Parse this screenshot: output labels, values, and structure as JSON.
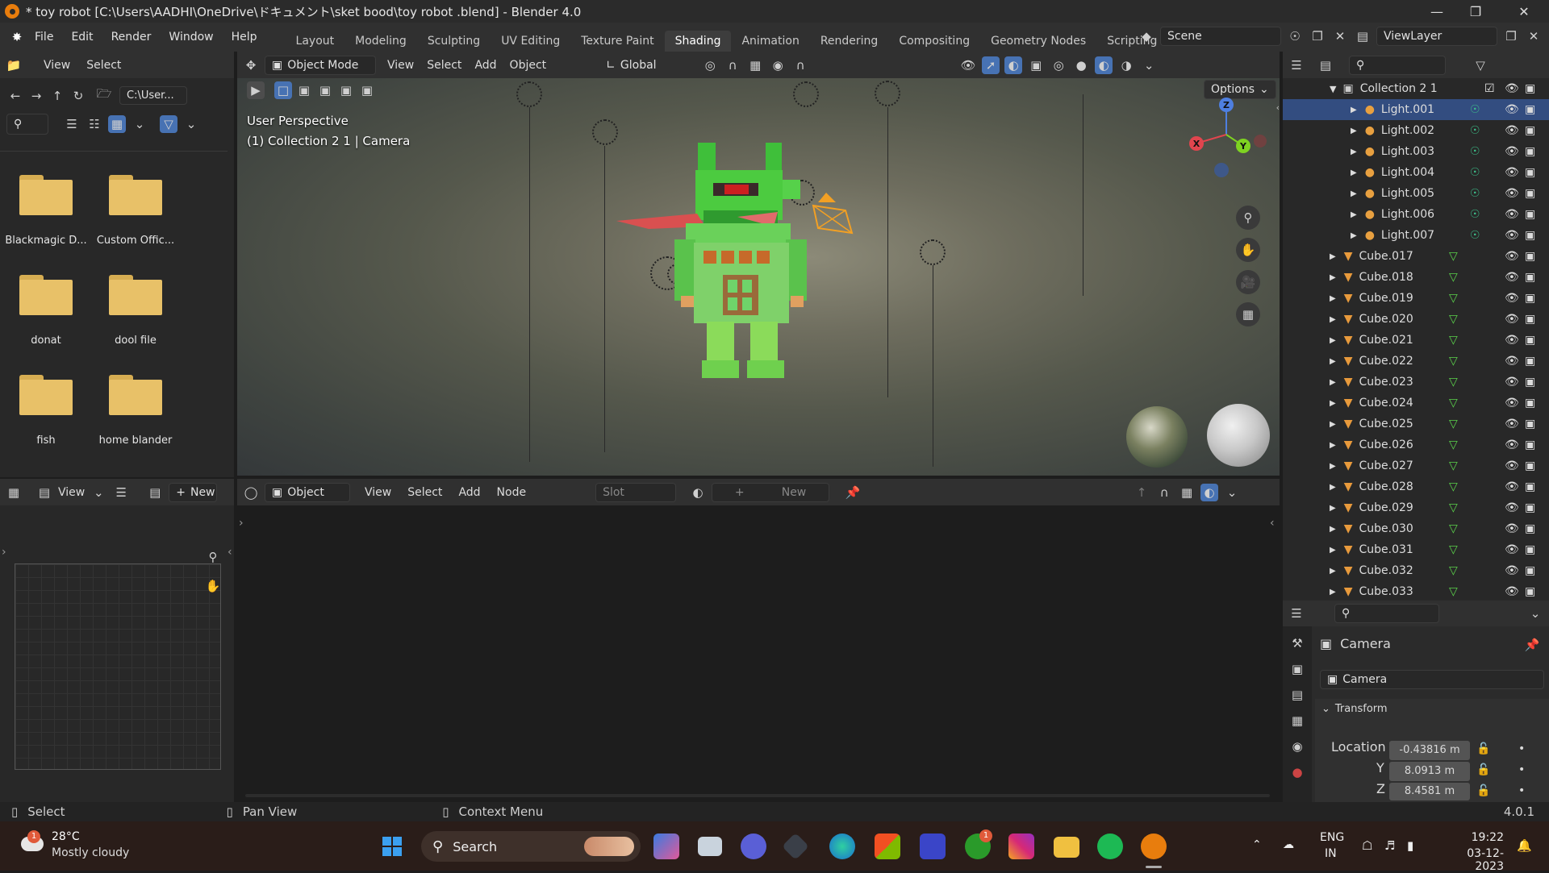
{
  "window": {
    "title": "* toy robot  [C:\\Users\\AADHI\\OneDrive\\ドキュメント\\sket bood\\toy robot .blend] - Blender 4.0"
  },
  "menu": [
    "File",
    "Edit",
    "Render",
    "Window",
    "Help"
  ],
  "workspaces": [
    "Layout",
    "Modeling",
    "Sculpting",
    "UV Editing",
    "Texture Paint",
    "Shading",
    "Animation",
    "Rendering",
    "Compositing",
    "Geometry Nodes",
    "Scripting"
  ],
  "active_workspace": "Shading",
  "scene": {
    "label": "Scene",
    "view_layer": "ViewLayer"
  },
  "filebrowser": {
    "view_label": "View",
    "select_label": "Select",
    "path": "C:\\User...",
    "folders": [
      "Blackmagic D...",
      "Custom Offic...",
      "donat",
      "dool file",
      "fish",
      "home blander"
    ]
  },
  "viewport": {
    "mode": "Object Mode",
    "menus": [
      "View",
      "Select",
      "Add",
      "Object"
    ],
    "transform": "Global",
    "options_label": "Options",
    "overlay_line1": "User Perspective",
    "overlay_line2": "(1) Collection 2 1 | Camera",
    "axes": {
      "x": "X",
      "y": "Y",
      "z": "Z"
    }
  },
  "image_editor": {
    "view_label": "View",
    "new_label": "New"
  },
  "node_editor": {
    "mode": "Object",
    "menus": [
      "View",
      "Select",
      "Add",
      "Node"
    ],
    "slot_label": "Slot",
    "new_label": "New"
  },
  "outliner": {
    "collection_label": "Collection 2 1",
    "lights": [
      "Light.001",
      "Light.002",
      "Light.003",
      "Light.004",
      "Light.005",
      "Light.006",
      "Light.007"
    ],
    "cubes": [
      "Cube.017",
      "Cube.018",
      "Cube.019",
      "Cube.020",
      "Cube.021",
      "Cube.022",
      "Cube.023",
      "Cube.024",
      "Cube.025",
      "Cube.026",
      "Cube.027",
      "Cube.028",
      "Cube.029",
      "Cube.030",
      "Cube.031",
      "Cube.032",
      "Cube.033"
    ]
  },
  "properties": {
    "object_name": "Camera",
    "data_name": "Camera",
    "panel": "Transform",
    "location_label": "Location X",
    "y_label": "Y",
    "z_label": "Z",
    "loc_x": "-0.43816 m",
    "loc_y": "8.0913 m",
    "loc_z": "8.4581 m"
  },
  "statusbar": {
    "select": "Select",
    "pan": "Pan View",
    "context": "Context Menu",
    "version": "4.0.1"
  },
  "taskbar": {
    "temp": "28°C",
    "weather": "Mostly cloudy",
    "search": "Search",
    "lang1": "ENG",
    "lang2": "IN",
    "time": "19:22",
    "date": "03-12-2023",
    "badge1": "1",
    "badge2": "1"
  }
}
